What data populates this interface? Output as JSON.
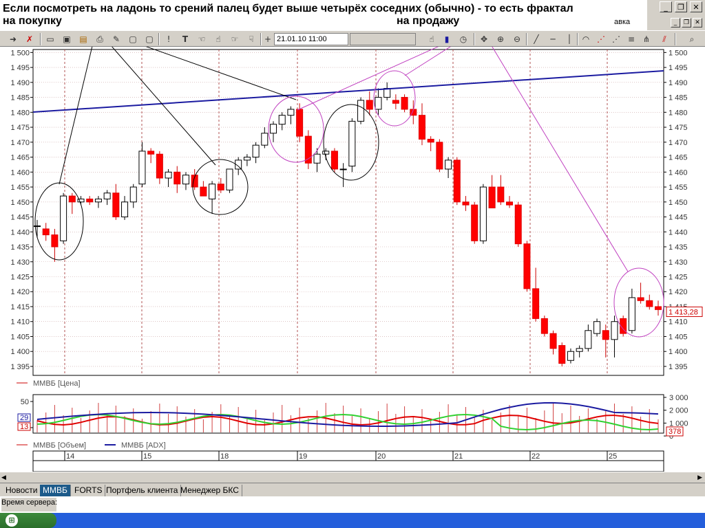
{
  "annotations": {
    "line1": "Если посмотреть на ладонь то срений палец будет выше четырёх соседних (обычно) - то есть фрактал",
    "buy": "на покупку",
    "sell": "на продажу"
  },
  "menu_tail": "авка",
  "toolbar": {
    "datetime": "21.01.10 11:00"
  },
  "price_axis": {
    "labels": [
      "1 500",
      "1 495",
      "1 490",
      "1 485",
      "1 480",
      "1 475",
      "1 470",
      "1 465",
      "1 460",
      "1 455",
      "1 450",
      "1 445",
      "1 440",
      "1 435",
      "1 430",
      "1 425",
      "1 420",
      "1 415",
      "1 410",
      "1 405",
      "1 400",
      "1 395"
    ],
    "current": "1 413,28"
  },
  "legends": {
    "price": "ММВБ [Цена]",
    "volume": "ММВБ [Объем]",
    "adx": "ММВБ [ADX]"
  },
  "indicator": {
    "left_labels": [
      "50",
      "0"
    ],
    "right_labels": [
      "3 000",
      "2 000",
      "1 000",
      "0"
    ],
    "badge_left_1": "29",
    "badge_left_2": "13",
    "badge_right": "378"
  },
  "dates": [
    "14",
    "15",
    "18",
    "19",
    "20",
    "21",
    "22",
    "25"
  ],
  "tabs": [
    "Новости",
    "ММВБ",
    "FORTS",
    "Портфель клиента",
    "Менеджер БКС"
  ],
  "active_tab": 1,
  "status": {
    "server_time_label": "Время сервера:"
  },
  "colors": {
    "up": "#ffffff",
    "down": "#ff0000",
    "trend": "#1a1aa0",
    "annot_pink": "#c040c0",
    "grid": "#b05050"
  },
  "chart_data": {
    "type": "candlestick",
    "ylim": [
      1392,
      1501
    ],
    "candles": [
      [
        1442,
        1444,
        1438,
        1442
      ],
      [
        1441,
        1443,
        1437,
        1439
      ],
      [
        1439,
        1441,
        1430,
        1435
      ],
      [
        1437,
        1453,
        1436,
        1452
      ],
      [
        1452,
        1453,
        1446,
        1450
      ],
      [
        1450,
        1452,
        1449,
        1451
      ],
      [
        1451,
        1452,
        1449,
        1450
      ],
      [
        1450,
        1452,
        1448,
        1451
      ],
      [
        1451,
        1454,
        1449,
        1453
      ],
      [
        1453,
        1456,
        1444,
        1445
      ],
      [
        1445,
        1452,
        1444,
        1450
      ],
      [
        1450,
        1456,
        1448,
        1455
      ],
      [
        1456,
        1470,
        1455,
        1467
      ],
      [
        1467,
        1468,
        1463,
        1466
      ],
      [
        1466,
        1467,
        1456,
        1458
      ],
      [
        1458,
        1461,
        1455,
        1460
      ],
      [
        1460,
        1462,
        1453,
        1456
      ],
      [
        1456,
        1460,
        1454,
        1459
      ],
      [
        1459,
        1461,
        1454,
        1455
      ],
      [
        1455,
        1457,
        1452,
        1452
      ],
      [
        1451,
        1457,
        1446,
        1456
      ],
      [
        1456,
        1458,
        1453,
        1454
      ],
      [
        1454,
        1461,
        1453,
        1461
      ],
      [
        1461,
        1465,
        1459,
        1464
      ],
      [
        1464,
        1466,
        1462,
        1465
      ],
      [
        1465,
        1470,
        1463,
        1469
      ],
      [
        1469,
        1475,
        1468,
        1473
      ],
      [
        1473,
        1477,
        1470,
        1476
      ],
      [
        1476,
        1480,
        1474,
        1479
      ],
      [
        1479,
        1482,
        1476,
        1481
      ],
      [
        1481,
        1483,
        1470,
        1472
      ],
      [
        1472,
        1474,
        1461,
        1463
      ],
      [
        1463,
        1468,
        1460,
        1466
      ],
      [
        1466,
        1468,
        1464,
        1467
      ],
      [
        1467,
        1468,
        1460,
        1461
      ],
      [
        1461,
        1463,
        1455,
        1461
      ],
      [
        1462,
        1478,
        1460,
        1477
      ],
      [
        1477,
        1485,
        1476,
        1484
      ],
      [
        1484,
        1487,
        1479,
        1481
      ],
      [
        1481,
        1488,
        1479,
        1485
      ],
      [
        1485,
        1490,
        1484,
        1488
      ],
      [
        1484,
        1486,
        1481,
        1483
      ],
      [
        1485,
        1486,
        1480,
        1481
      ],
      [
        1481,
        1484,
        1476,
        1479
      ],
      [
        1479,
        1483,
        1469,
        1471
      ],
      [
        1471,
        1472,
        1467,
        1470
      ],
      [
        1470,
        1471,
        1460,
        1461
      ],
      [
        1461,
        1465,
        1458,
        1464
      ],
      [
        1464,
        1465,
        1449,
        1450
      ],
      [
        1450,
        1452,
        1447,
        1449
      ],
      [
        1449,
        1450,
        1436,
        1437
      ],
      [
        1437,
        1456,
        1436,
        1455
      ],
      [
        1455,
        1459,
        1448,
        1448
      ],
      [
        1455,
        1459,
        1449,
        1450
      ],
      [
        1450,
        1452,
        1448,
        1449
      ],
      [
        1449,
        1450,
        1435,
        1436
      ],
      [
        1436,
        1437,
        1420,
        1421
      ],
      [
        1421,
        1428,
        1410,
        1411
      ],
      [
        1411,
        1412,
        1405,
        1406
      ],
      [
        1406,
        1407,
        1399,
        1401
      ],
      [
        1402,
        1403,
        1395,
        1396
      ],
      [
        1397,
        1401,
        1396,
        1400
      ],
      [
        1400,
        1402,
        1398,
        1401
      ],
      [
        1401,
        1409,
        1400,
        1407
      ],
      [
        1406,
        1411,
        1405,
        1410
      ],
      [
        1407,
        1409,
        1398,
        1404
      ],
      [
        1404,
        1412,
        1398,
        1410
      ],
      [
        1411,
        1412,
        1405,
        1406
      ],
      [
        1407,
        1421,
        1406,
        1418
      ],
      [
        1418,
        1423,
        1416,
        1417
      ],
      [
        1417,
        1419,
        1414,
        1415
      ],
      [
        1415,
        1417,
        1412,
        1414
      ]
    ]
  }
}
